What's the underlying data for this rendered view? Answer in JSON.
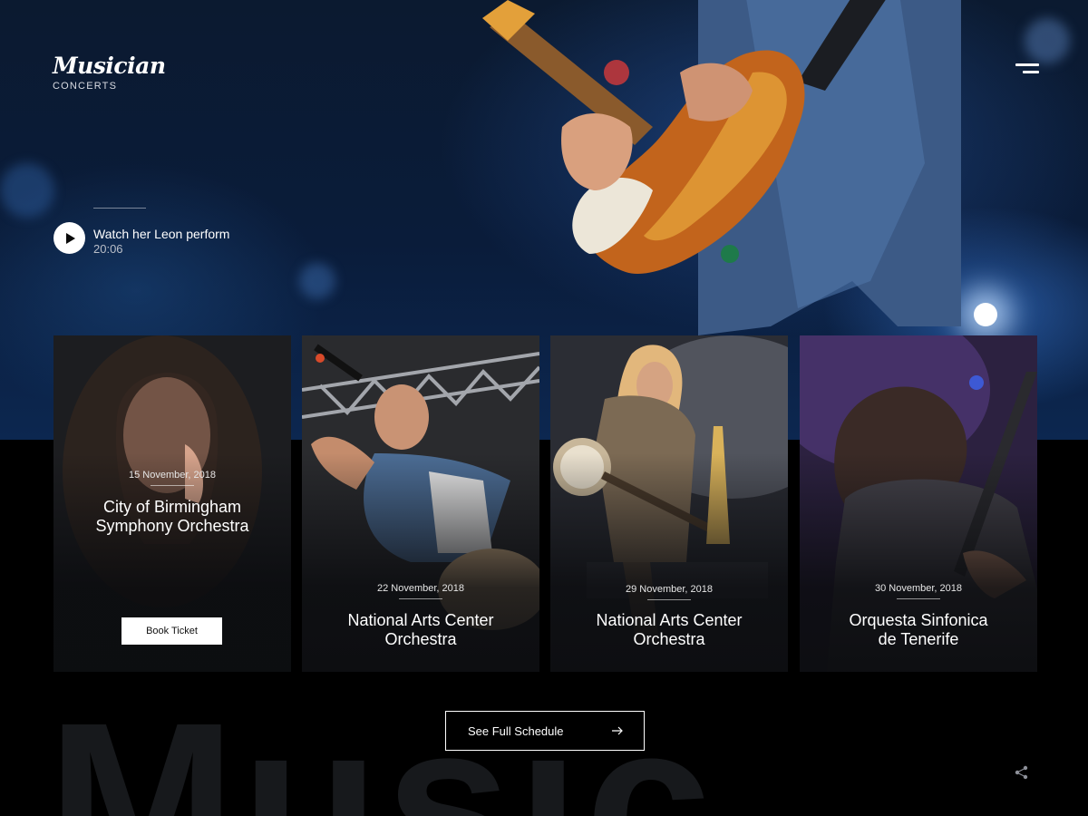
{
  "brand": {
    "name": "Musician",
    "sub": "CONCERTS"
  },
  "header": {
    "menu_icon": "menu-icon"
  },
  "video": {
    "title": "Watch her Leon perform",
    "duration": "20:06",
    "icon": "play-icon"
  },
  "cards": [
    {
      "date": "15 November, 2018",
      "title": "City of Birmingham\nSymphony Orchestra",
      "button": "Book Ticket"
    },
    {
      "date": "22 November, 2018",
      "title": "National Arts Center\nOrchestra"
    },
    {
      "date": "29 November, 2018",
      "title": "National Arts Center\nOrchestra"
    },
    {
      "date": "30 November, 2018",
      "title": "Orquesta Sinfonica\nde Tenerife"
    }
  ],
  "schedule": {
    "label": "See Full Schedule",
    "icon": "arrow-right-icon"
  },
  "watermark": "Music",
  "footer": {
    "share_icon": "share-icon"
  },
  "colors": {
    "background": "#000000",
    "hero_blue": "#0c2750",
    "text": "#ffffff",
    "watermark": "#17191c"
  }
}
